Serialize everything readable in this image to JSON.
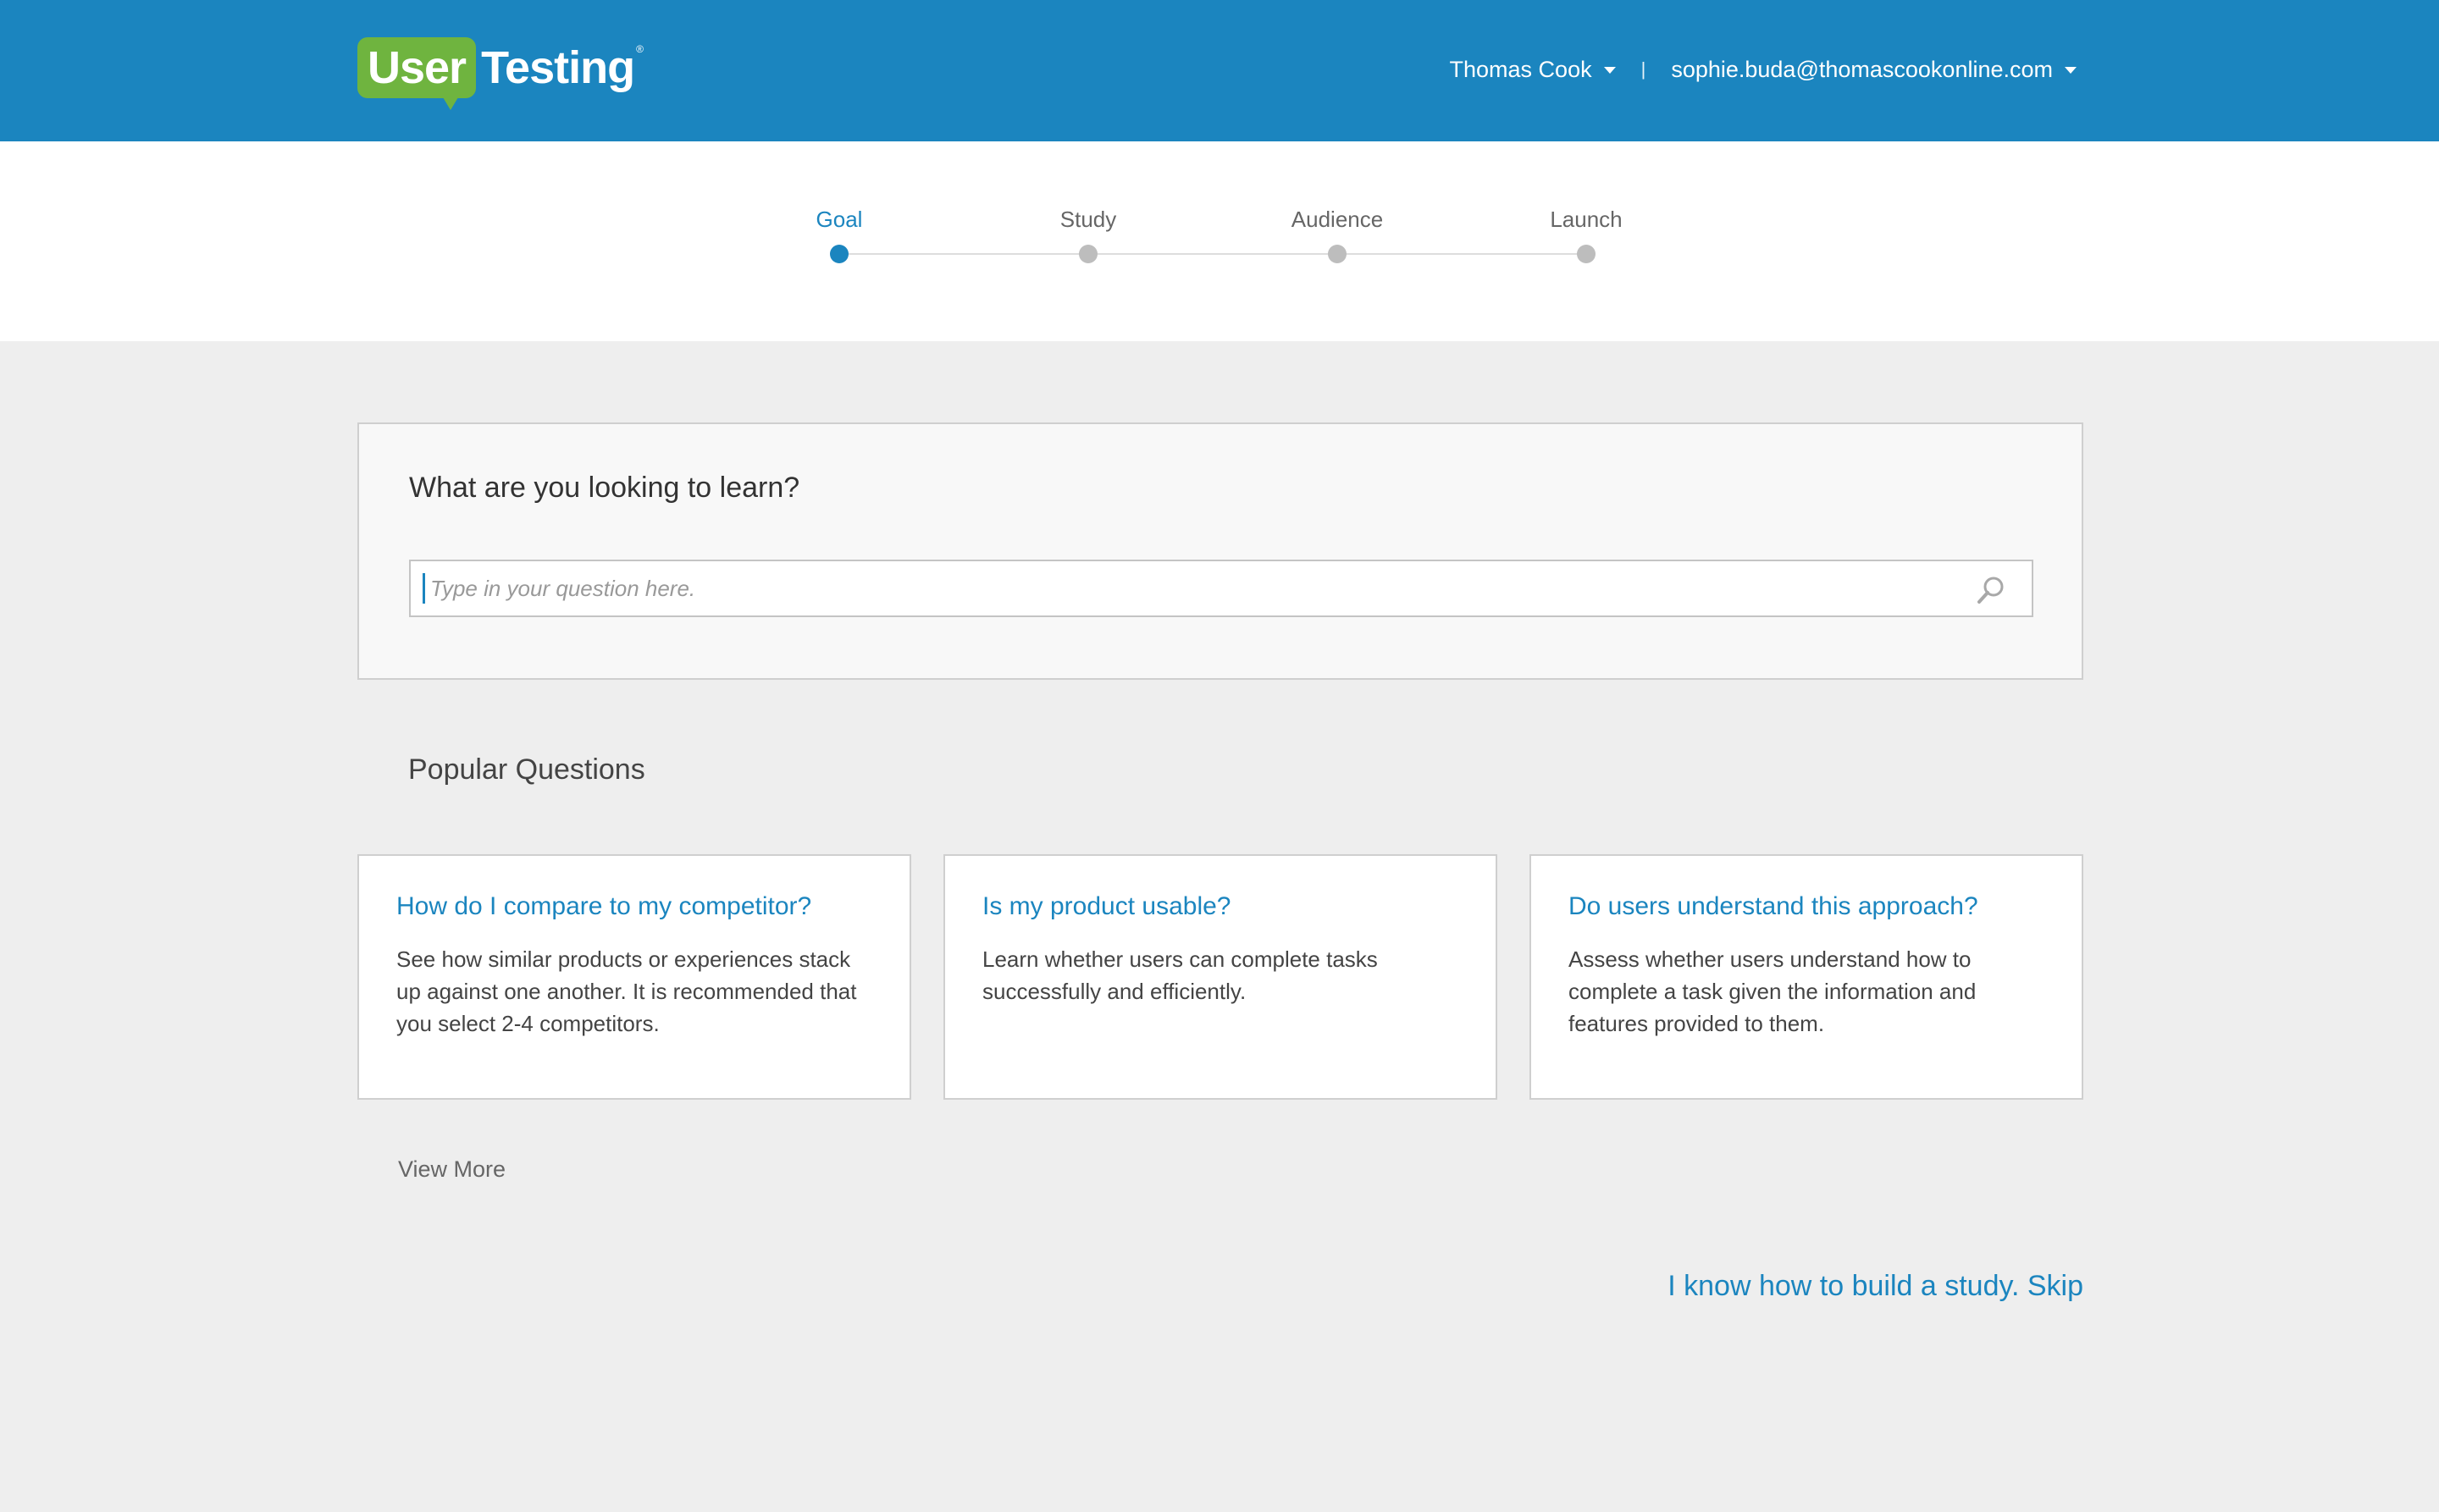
{
  "header": {
    "logo_part1": "User",
    "logo_part2": "Testing",
    "logo_reg": "®",
    "account_name": "Thomas Cook",
    "separator": "|",
    "user_email": "sophie.buda@thomascookonline.com"
  },
  "stepper": {
    "steps": [
      {
        "label": "Goal",
        "active": true
      },
      {
        "label": "Study",
        "active": false
      },
      {
        "label": "Audience",
        "active": false
      },
      {
        "label": "Launch",
        "active": false
      }
    ]
  },
  "question": {
    "title": "What are you looking to learn?",
    "placeholder": "Type in your question here.",
    "value": ""
  },
  "popular": {
    "heading": "Popular Questions",
    "cards": [
      {
        "title": "How do I compare to my competitor?",
        "description": "See how similar products or experiences stack up against one another. It is recommended that you select 2-4 competitors."
      },
      {
        "title": "Is my product usable?",
        "description": "Learn whether users can complete tasks successfully and efficiently."
      },
      {
        "title": "Do users understand this approach?",
        "description": "Assess whether users understand how to complete a task given the information and features provided to them."
      }
    ],
    "view_more": "View More"
  },
  "skip_link": "I know how to build a study. Skip",
  "colors": {
    "brand_blue": "#1b85bf",
    "logo_green": "#6fb43f",
    "page_bg": "#eeeeee",
    "inactive_dot": "#bdbdbd"
  },
  "icons": {
    "search": "search-icon",
    "account_caret": "chevron-down-icon",
    "email_caret": "chevron-down-icon"
  }
}
